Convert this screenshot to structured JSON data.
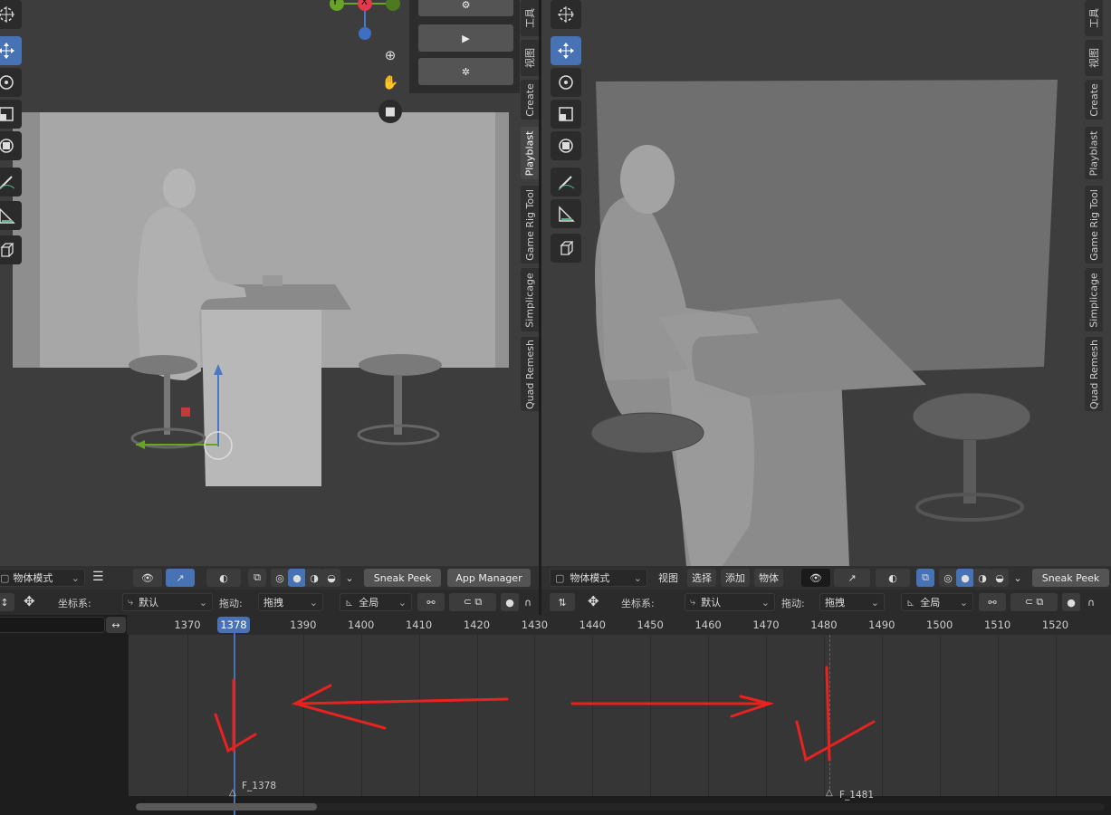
{
  "left_view": {
    "tool_icons": [
      "cursor-icon",
      "move-icon",
      "rotate-icon",
      "scale-icon",
      "transform-icon",
      "annotate-icon",
      "measure-icon",
      "add-cube-icon"
    ],
    "gizmo": {
      "y_label": "Y",
      "x_label": "X"
    },
    "nav_icons": [
      "zoom-icon",
      "hand-icon",
      "camera-icon"
    ],
    "panel_buttons": [
      "film-icon",
      "play-icon",
      "settings-icon"
    ],
    "ntabs": [
      "工具",
      "视图",
      "Create",
      "Playblast",
      "Game Rig Tool",
      "Simplicage",
      "Quad Remesh"
    ],
    "ntab_active": "Playblast",
    "header": {
      "mode": "物体模式",
      "sneak_peek": "Sneak Peek",
      "app_manager": "App Manager"
    },
    "header2": {
      "coord_label": "坐标系:",
      "coord_value": "默认",
      "drag_label": "拖动:",
      "drag_value": "拖拽",
      "pivot_value": "全局"
    }
  },
  "right_view": {
    "ntabs": [
      "工具",
      "视图",
      "Create",
      "Playblast",
      "Game Rig Tool",
      "Simplicage",
      "Quad Remesh"
    ],
    "header": {
      "mode": "物体模式",
      "menu": [
        "视图",
        "选择",
        "添加",
        "物体"
      ],
      "sneak_peek": "Sneak Peek"
    },
    "header2": {
      "coord_label": "坐标系:",
      "coord_value": "默认",
      "drag_label": "拖动:",
      "drag_value": "拖拽",
      "pivot_value": "全局"
    }
  },
  "timeline": {
    "current_frame": "1378",
    "ticks": [
      "1370",
      "1390",
      "1400",
      "1410",
      "1420",
      "1430",
      "1440",
      "1450",
      "1460",
      "1470",
      "1480",
      "1490",
      "1500",
      "1510",
      "1520"
    ],
    "markers": [
      {
        "label": "F_1378"
      },
      {
        "label": "F_1481"
      }
    ]
  },
  "colors": {
    "accent": "#4772b3",
    "annotation": "#e8231f",
    "bg": "#1d1d1d",
    "panel": "#303030"
  }
}
